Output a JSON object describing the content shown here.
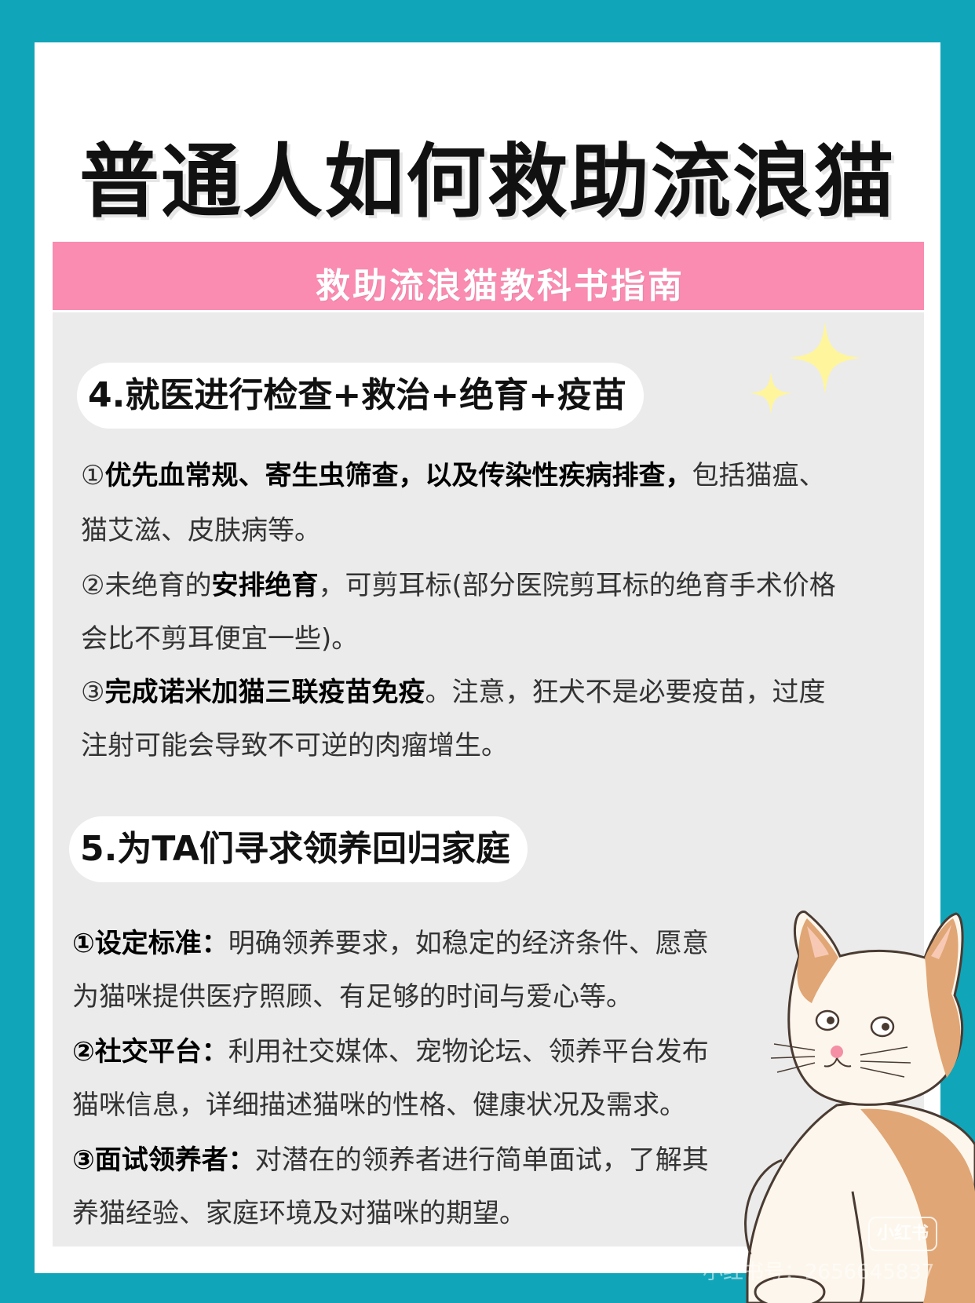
{
  "title": "普通人如何救助流浪猫",
  "subtitle": "救助流浪猫教科书指南",
  "section4": {
    "heading": "4.就医进行检查+救治+绝育+疫苗",
    "item1": {
      "marker": "①",
      "bold": "优先血常规、寄生虫筛查，以及传染性疾病排查，",
      "text_a": "包括猫瘟、",
      "text_b": "猫艾滋、皮肤病等。"
    },
    "item2": {
      "marker": "②",
      "pre": "未绝育的",
      "bold": "安排绝育",
      "text_a": "，可剪耳标(部分医院剪耳标的绝育手术价格",
      "text_b": "会比不剪耳便宜一些)。"
    },
    "item3": {
      "marker": "③",
      "bold": "完成诺米加猫三联疫苗免疫",
      "text_a": "。注意，狂犬不是必要疫苗，过度",
      "text_b": "注射可能会导致不可逆的肉瘤增生。"
    }
  },
  "section5": {
    "heading": "5.为TA们寻求领养回归家庭",
    "item1": {
      "bold": "①设定标准：",
      "text_a": "明确领养要求，如稳定的经济条件、愿意",
      "text_b": "为猫咪提供医疗照顾、有足够的时间与爱心等。"
    },
    "item2": {
      "bold": "②社交平台：",
      "text_a": "利用社交媒体、宠物论坛、领养平台发布",
      "text_b": "猫咪信息，详细描述猫咪的性格、健康状况及需求。"
    },
    "item3": {
      "bold": "③面试领养者：",
      "text_a": "对潜在的领养者进行简单面试，了解其",
      "text_b": "养猫经验、家庭环境及对猫咪的期望。"
    }
  },
  "watermark": {
    "logo": "小红书",
    "text": "小红书号：2656645837"
  },
  "colors": {
    "frame": "#11a5ba",
    "header_pink": "#f98cb0",
    "panel_gray": "#ebebeb"
  }
}
